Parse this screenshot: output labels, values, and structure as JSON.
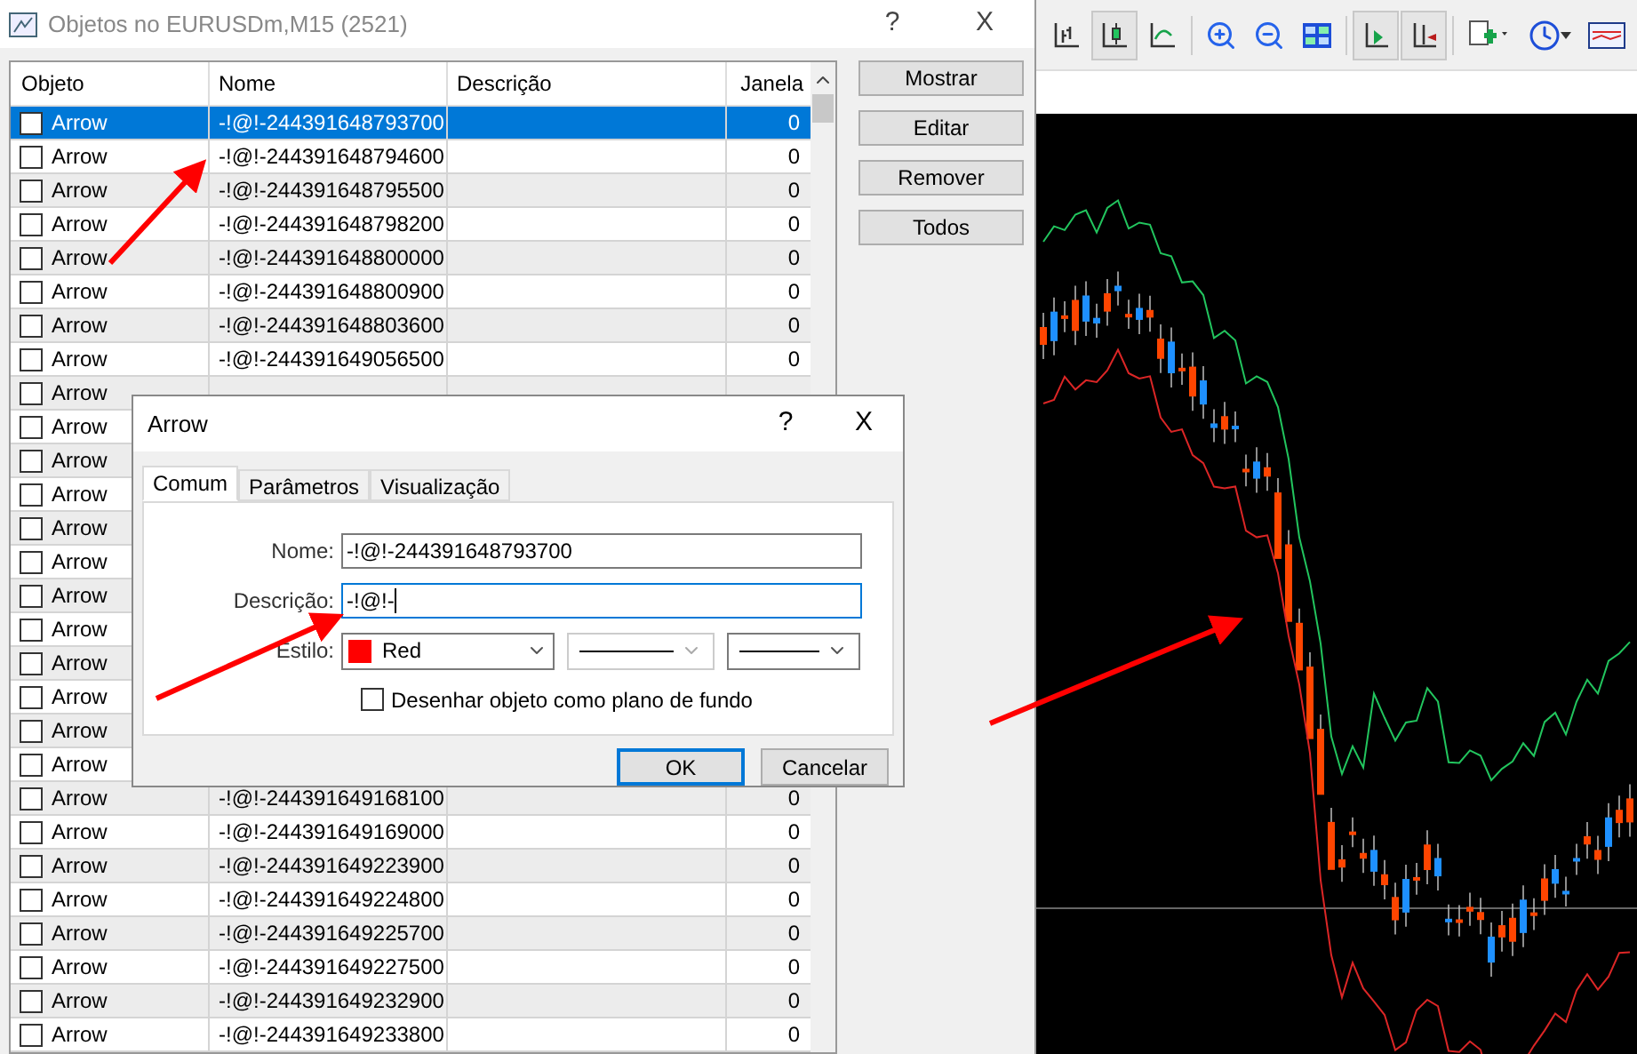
{
  "list_window": {
    "title": "Objetos no EURUSDm,M15 (2521)",
    "help": "?",
    "close": "X"
  },
  "table": {
    "columns": [
      "Objeto",
      "Nome",
      "Descrição",
      "Janela"
    ],
    "rows": [
      {
        "object": "Arrow",
        "name": "-!@!-244391648793700",
        "janela": "0",
        "checked": false,
        "selected": true
      },
      {
        "object": "Arrow",
        "name": "-!@!-244391648794600",
        "janela": "0",
        "checked": false,
        "selected": false
      },
      {
        "object": "Arrow",
        "name": "-!@!-244391648795500",
        "janela": "0",
        "checked": false,
        "selected": false
      },
      {
        "object": "Arrow",
        "name": "-!@!-244391648798200",
        "janela": "0",
        "checked": false,
        "selected": false
      },
      {
        "object": "Arrow",
        "name": "-!@!-244391648800000",
        "janela": "0",
        "checked": false,
        "selected": false
      },
      {
        "object": "Arrow",
        "name": "-!@!-244391648800900",
        "janela": "0",
        "checked": false,
        "selected": false
      },
      {
        "object": "Arrow",
        "name": "-!@!-244391648803600",
        "janela": "0",
        "checked": false,
        "selected": false
      },
      {
        "object": "Arrow",
        "name": "-!@!-244391649056500",
        "janela": "0",
        "checked": false,
        "selected": false
      },
      {
        "object": "Arrow",
        "checked": false,
        "selected": false
      },
      {
        "object": "Arrow",
        "checked": false,
        "selected": false
      },
      {
        "object": "Arrow",
        "checked": false,
        "selected": false
      },
      {
        "object": "Arrow",
        "checked": false,
        "selected": false
      },
      {
        "object": "Arrow",
        "checked": false,
        "selected": false
      },
      {
        "object": "Arrow",
        "checked": false,
        "selected": false
      },
      {
        "object": "Arrow",
        "checked": false,
        "selected": false
      },
      {
        "object": "Arrow",
        "checked": false,
        "selected": false
      },
      {
        "object": "Arrow",
        "checked": false,
        "selected": false
      },
      {
        "object": "Arrow",
        "checked": false,
        "selected": false
      },
      {
        "object": "Arrow",
        "checked": false,
        "selected": false
      },
      {
        "object": "Arrow",
        "checked": false,
        "selected": false
      },
      {
        "object": "Arrow",
        "name": "-!@!-244391649168100",
        "janela": "0",
        "checked": false,
        "selected": false
      },
      {
        "object": "Arrow",
        "name": "-!@!-244391649169000",
        "janela": "0",
        "checked": false,
        "selected": false
      },
      {
        "object": "Arrow",
        "name": "-!@!-244391649223900",
        "janela": "0",
        "checked": false,
        "selected": false
      },
      {
        "object": "Arrow",
        "name": "-!@!-244391649224800",
        "janela": "0",
        "checked": false,
        "selected": false
      },
      {
        "object": "Arrow",
        "name": "-!@!-244391649225700",
        "janela": "0",
        "checked": false,
        "selected": false
      },
      {
        "object": "Arrow",
        "name": "-!@!-244391649227500",
        "janela": "0",
        "checked": false,
        "selected": false
      },
      {
        "object": "Arrow",
        "name": "-!@!-244391649232900",
        "janela": "0",
        "checked": false,
        "selected": false
      },
      {
        "object": "Arrow",
        "name": "-!@!-244391649233800",
        "janela": "0",
        "checked": false,
        "selected": false
      }
    ]
  },
  "side_buttons": [
    "Mostrar",
    "Editar",
    "Remover",
    "Todos"
  ],
  "toolbar": [
    {
      "kind": "bar",
      "selected": false
    },
    {
      "kind": "candle",
      "selected": true
    },
    {
      "kind": "line",
      "selected": false
    },
    {
      "kind": "zoom_in",
      "selected": false
    },
    {
      "kind": "zoom_out",
      "selected": false
    },
    {
      "kind": "tile",
      "selected": false
    },
    {
      "kind": "shift",
      "selected": true
    },
    {
      "kind": "autoscroll",
      "selected": true
    },
    {
      "kind": "add",
      "selected": false
    },
    {
      "kind": "clock",
      "selected": false
    },
    {
      "kind": "template",
      "selected": false
    }
  ],
  "dialog": {
    "title": "Arrow",
    "help": "?",
    "close": "X",
    "tabs": [
      {
        "label": "Comum",
        "selected": true
      },
      {
        "label": "Parâmetros",
        "selected": false
      },
      {
        "label": "Visualização",
        "selected": false
      }
    ],
    "fields": [
      {
        "label": "Nome:",
        "value": "-!@!-244391648793700",
        "focused": false
      },
      {
        "label": "Descrição:",
        "value": "-!@!-",
        "focused": true
      }
    ],
    "style": {
      "label": "Estilo:",
      "color_name": "Red",
      "color": "#ff0000"
    },
    "background_checkbox": {
      "label": "Desenhar objeto como plano de fundo",
      "checked": false
    },
    "buttons": [
      {
        "label": "OK",
        "default": true
      },
      {
        "label": "Cancelar",
        "default": false
      }
    ]
  }
}
